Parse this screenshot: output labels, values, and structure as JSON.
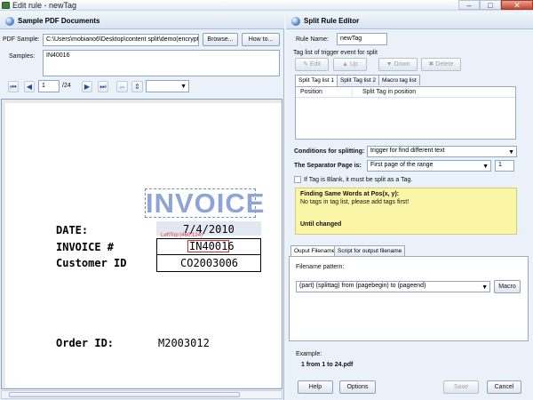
{
  "window": {
    "title": "Edit rule - newTag",
    "minimize": "–",
    "maximize": "□",
    "close": "✕"
  },
  "left": {
    "panel_title": "Sample PDF Documents",
    "pdf_sample_label": "PDF Sample:",
    "pdf_sample_value": "C:\\Users\\mobiano6\\Desktop\\content split\\demo(encrypte",
    "browse": "Browse...",
    "howto": "How to...",
    "samples_label": "Samples:",
    "samples_value": "IN40016",
    "page_current": "1",
    "page_total": "/24",
    "zoom_value": ""
  },
  "document": {
    "invoice": "INVOICE",
    "date_label": "DATE:",
    "date_value": "7/4/2010",
    "lefttop": "LeftTop:(460,124)",
    "invoice_label": "INVOICE #",
    "invoice_value": "IN40016",
    "customer_label": "Customer ID",
    "customer_value": "CO2003006",
    "order_label": "Order ID:",
    "order_value": "M2003012"
  },
  "right": {
    "panel_title": "Split Rule Editor",
    "rule_name_label": "Rule Name:",
    "rule_name_value": "newTag",
    "tag_list_label": "Tag list of trigger event for split",
    "edit": "Edit",
    "up": "Up",
    "down": "Down",
    "delete": "Delete",
    "tabs": [
      "Split Tag list 1",
      "Split Tag list 2",
      "Macro tag list"
    ],
    "col_position": "Position",
    "col_split_tag": "Split Tag in position",
    "conditions_label": "Conditions for splitting:",
    "conditions_value": "trigger for find different text",
    "separator_label": "The Separator Page is:",
    "separator_value": "First page of the range",
    "separator_num": "1",
    "blank_check": "If Tag is Blank, it must be split as a Tag.",
    "finding_title": "Finding Same Words at Pos(x, y):",
    "finding_msg": "No tags in tag list, please add tags first!",
    "until_changed": "Until changed",
    "output_tabs": [
      "Ouput Filename",
      "Script for output filename"
    ],
    "filename_label": "Filename pattern:",
    "filename_value": "(part) (splittag) from (pagebegin) to (pageend)",
    "macro": "Macro",
    "example_label": "Example:",
    "example_value": "1  from 1 to 24.pdf",
    "help": "Help",
    "options": "Options",
    "save": "Save",
    "cancel": "Cancel"
  }
}
